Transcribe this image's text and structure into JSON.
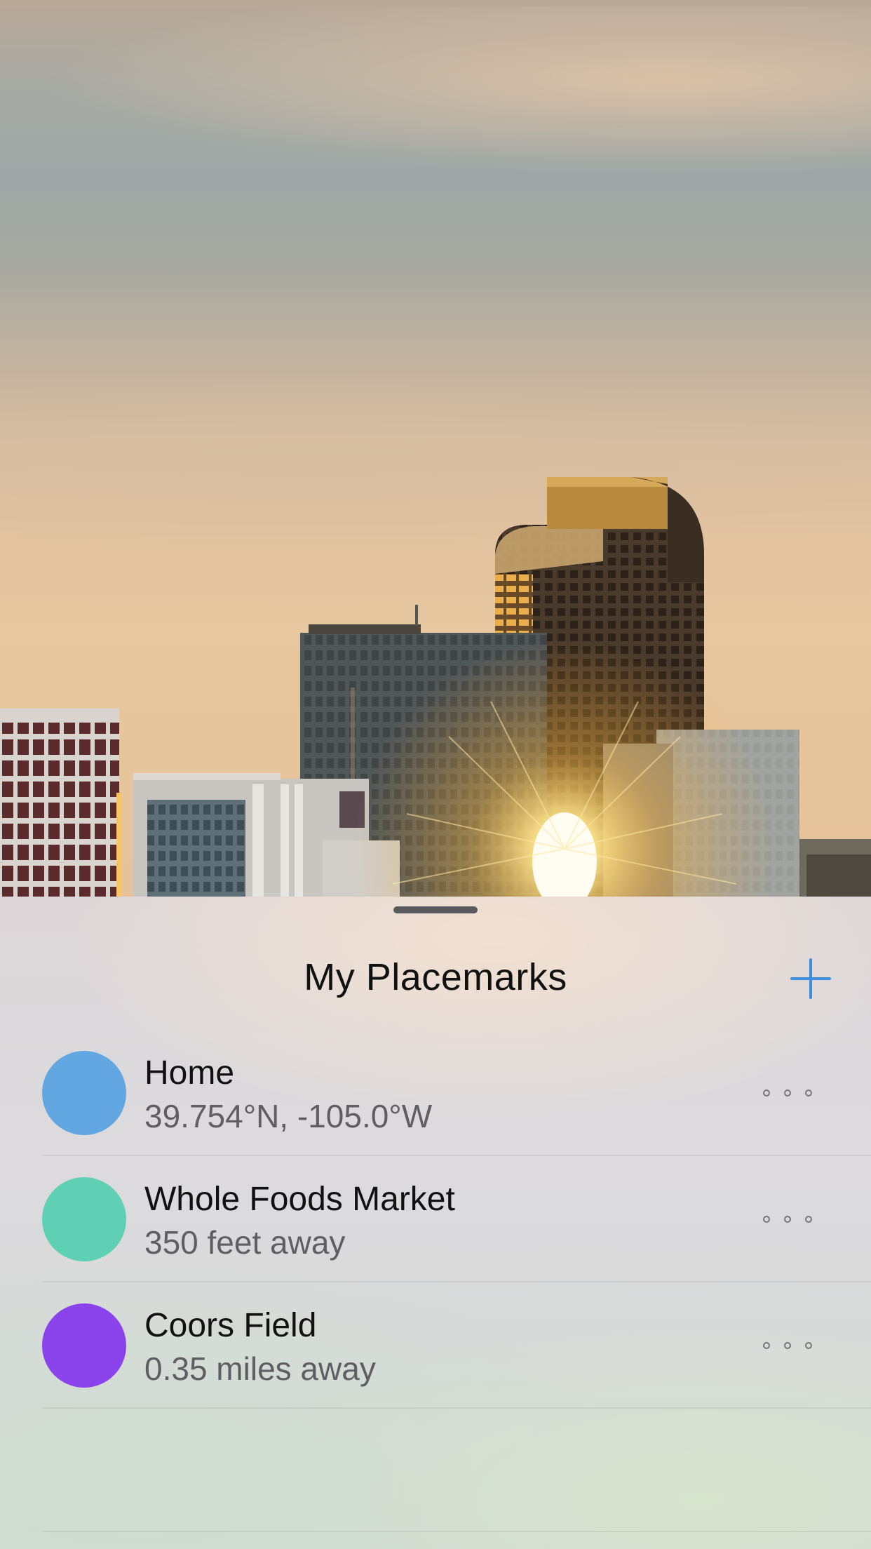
{
  "sheet": {
    "title": "My Placemarks",
    "add_icon": "plus-icon",
    "accent_color": "#3b8ee0"
  },
  "placemarks": [
    {
      "name": "Home",
      "detail": "39.754°N, -105.0°W",
      "color": "#62a6e2"
    },
    {
      "name": "Whole Foods Market",
      "detail": "350 feet away",
      "color": "#5fd0b4"
    },
    {
      "name": "Coors Field",
      "detail": "0.35 miles away",
      "color": "#8b44ec"
    }
  ],
  "row_action_icon": "more-dots-icon"
}
